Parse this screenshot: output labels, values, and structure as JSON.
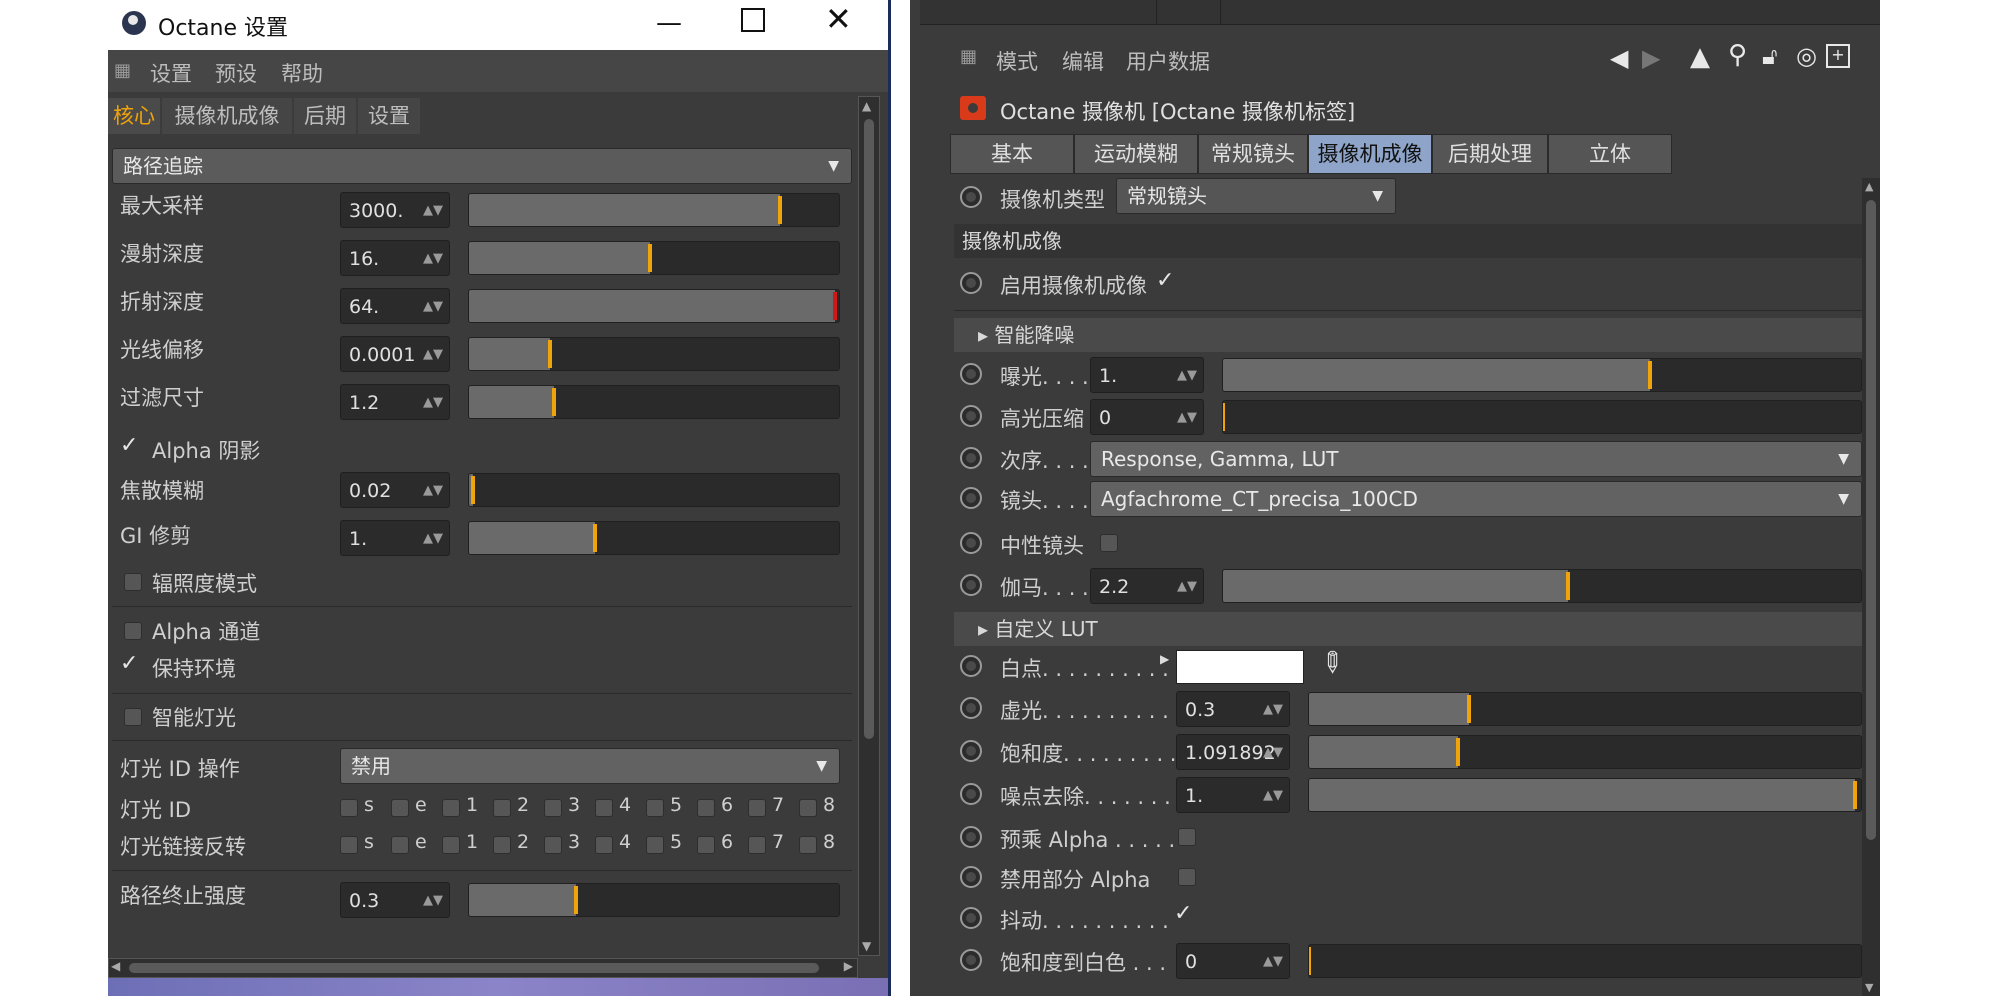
{
  "left": {
    "title": "Octane 设置",
    "menu": [
      "设置",
      "预设",
      "帮助"
    ],
    "tabs": [
      "核心",
      "摄像机成像",
      "后期",
      "设置"
    ],
    "kernel": "路径追踪",
    "rows": [
      {
        "label": "最大采样",
        "value": "3000.",
        "fill": 0.84
      },
      {
        "label": "漫射深度",
        "value": "16.",
        "fill": 0.49
      },
      {
        "label": "折射深度",
        "value": "64.",
        "fill": 0.99
      },
      {
        "label": "光线偏移",
        "value": "0.0001",
        "fill": 0.22
      },
      {
        "label": "过滤尺寸",
        "value": "1.2",
        "fill": 0.23
      }
    ],
    "alpha_shadow": "Alpha 阴影",
    "caustic_label": "焦散模糊",
    "caustic_value": "0.02",
    "caustic_fill": 0.01,
    "gi_label": "GI 修剪",
    "gi_value": "1.",
    "gi_fill": 0.34,
    "irradiance": "辐照度模式",
    "alpha_channel": "Alpha 通道",
    "keep_env": "保持环境",
    "smart_light": "智能灯光",
    "light_id_op_label": "灯光 ID 操作",
    "light_id_op_value": "禁用",
    "light_id_label": "灯光 ID",
    "light_link_label": "灯光链接反转",
    "id_items": [
      "s",
      "e",
      "1",
      "2",
      "3",
      "4",
      "5",
      "6",
      "7",
      "8"
    ],
    "path_term_label": "路径终止强度",
    "path_term_value": "0.3",
    "path_term_fill": 0.29
  },
  "right": {
    "menu": [
      "模式",
      "编辑",
      "用户数据"
    ],
    "tag_title": "Octane 摄像机 [Octane 摄像机标签]",
    "tabs": [
      "基本",
      "运动模糊",
      "常规镜头",
      "摄像机成像",
      "后期处理",
      "立体"
    ],
    "camera_type_label": "摄像机类型",
    "camera_type_value": "常规镜头",
    "section_title": "摄像机成像",
    "enable_imager": "启用摄像机成像",
    "smart_denoise": "▸ 智能降噪",
    "exposure_label": "曝光. . . .",
    "exposure_value": "1.",
    "exposure_fill": 0.67,
    "highlight_label": "高光压缩",
    "highlight_value": "0",
    "highlight_fill": 0.0,
    "order_label": "次序. . . .",
    "order_value": "Response, Gamma, LUT",
    "lens_label": "镜头. . . .",
    "lens_value": "Agfachrome_CT_precisa_100CD",
    "neutral_label": "中性镜头",
    "gamma_label": "伽马. . . .",
    "gamma_value": "2.2",
    "gamma_fill": 0.54,
    "custom_lut": "▸ 自定义 LUT",
    "white_point_label": "白点. . . . . . . . . .",
    "vignette_label": "虚光. . . . . . . . . .",
    "vignette_value": "0.3",
    "vignette_fill": 0.29,
    "saturation_label": "饱和度. . . . . . . . .",
    "saturation_value": "1.091892",
    "saturation_fill": 0.27,
    "hotpixel_label": "噪点去除. . . . . . .",
    "hotpixel_value": "1.",
    "hotpixel_fill": 0.99,
    "premult_label": "预乘 Alpha . . . . .",
    "disable_partial_label": "禁用部分 Alpha",
    "dither_label": "抖动. . . . . . . . . .",
    "sat_to_white_label": "饱和度到白色 . . .",
    "sat_to_white_value": "0",
    "sat_to_white_fill": 0.0
  },
  "colors": {
    "panel": "#3b3b3b",
    "accent": "#f0a30a",
    "active_tab": "#8ea5c9"
  }
}
